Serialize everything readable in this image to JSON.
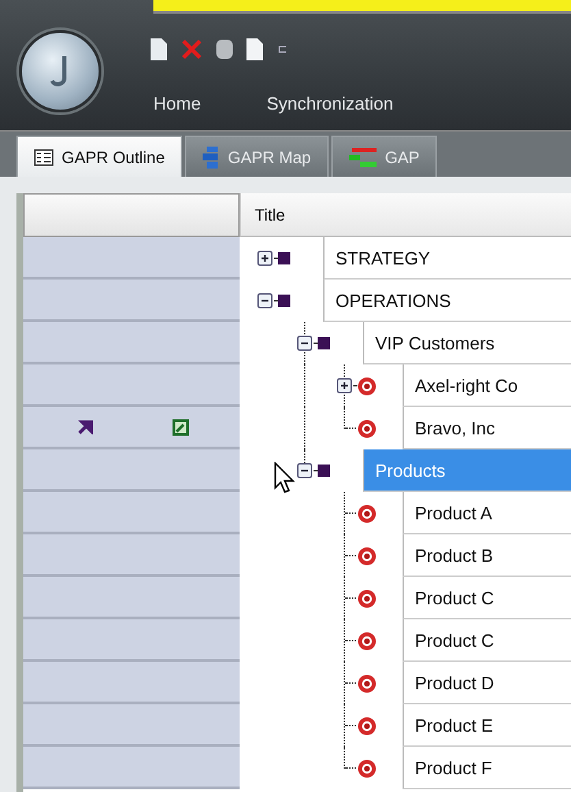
{
  "ribbon": {
    "tabs": [
      {
        "label": "Home",
        "selected": false
      },
      {
        "label": "Synchronization",
        "selected": false
      }
    ]
  },
  "doc_tabs": [
    {
      "label": "GAPR Outline",
      "selected": true,
      "kind": "outline"
    },
    {
      "label": "GAPR Map",
      "selected": false,
      "kind": "map"
    },
    {
      "label": "GAP",
      "selected": false,
      "kind": "gantt"
    }
  ],
  "grid": {
    "title_header": "Title",
    "rows": [
      {
        "title": "STRATEGY",
        "kind": "group",
        "expanded": false,
        "selected": false
      },
      {
        "title": "OPERATIONS",
        "kind": "group",
        "expanded": true,
        "selected": false,
        "children": [
          {
            "title": "VIP Customers",
            "kind": "group",
            "expanded": true,
            "selected": false,
            "children": [
              {
                "title": "Axel-right Co",
                "kind": "item",
                "expanded": false,
                "selected": false
              },
              {
                "title": "Bravo, Inc",
                "kind": "item",
                "selected": false,
                "actions": true
              }
            ]
          },
          {
            "title": "Products",
            "kind": "group",
            "expanded": true,
            "selected": true,
            "children": [
              {
                "title": "Product A",
                "kind": "item",
                "selected": false
              },
              {
                "title": "Product B",
                "kind": "item",
                "selected": false
              },
              {
                "title": "Product C",
                "kind": "item",
                "selected": false
              },
              {
                "title": "Product C",
                "kind": "item",
                "selected": false
              },
              {
                "title": "Product D",
                "kind": "item",
                "selected": false
              },
              {
                "title": "Product E",
                "kind": "item",
                "selected": false
              },
              {
                "title": "Product F",
                "kind": "item",
                "selected": false
              }
            ]
          }
        ]
      }
    ]
  }
}
